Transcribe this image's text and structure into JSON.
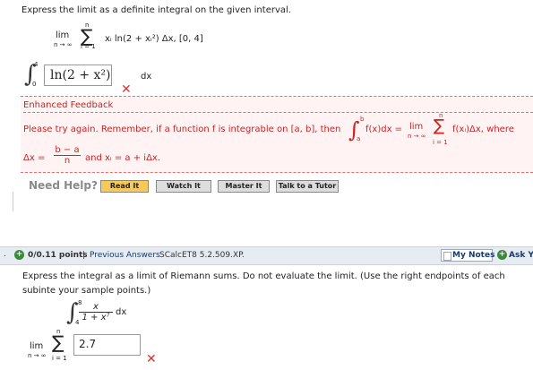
{
  "q1": {
    "prompt": "Express the limit as a definite integral on the given interval.",
    "lim_label": "lim",
    "lim_sub": "n → ∞",
    "sigma_top": "n",
    "sigma_bottom": "i = 1",
    "expression": "xᵢ ln(2 + xᵢ²) Δx,  [0, 4]",
    "answer_upper": "4",
    "answer_lower": "0",
    "answer_value": "ln(2 + x²)",
    "dx": "dx"
  },
  "feedback": {
    "title": "Enhanced Feedback",
    "text_part1": "Please try again. Remember, if a function f is integrable on  [a, b],  then",
    "int_upper": "b",
    "int_lower": "a",
    "int_body": "f(x)dx = ",
    "lim_label": "lim",
    "lim_sub": "n → ∞",
    "sigma_top": "n",
    "sigma_bottom": "i = 1",
    "sum_body": "f(xᵢ)Δx,  where",
    "delta_lhs": "Δx = ",
    "frac_num": "b − a",
    "frac_den": "n",
    "and_text": "and  xᵢ = a + iΔx."
  },
  "help": {
    "label": "Need Help?",
    "buttons": [
      "Read It",
      "Watch It",
      "Master It",
      "Talk to a Tutor"
    ]
  },
  "q2bar": {
    "number": ".",
    "points": "0/0.11 points",
    "sep": "|",
    "prev": "Previous Answers",
    "source": "SCalcET8 5.2.509.XP.",
    "my_notes": "My Notes",
    "ask": "Ask Yo"
  },
  "q2": {
    "prompt": "Express the integral as a limit of Riemann sums. Do not evaluate the limit. (Use the right endpoints of each subinte your sample points.)",
    "int_upper": "8",
    "int_lower": "4",
    "frac_num": "x",
    "frac_den": "1 + x⁷",
    "dx": "dx",
    "lim_label": "lim",
    "lim_sub": "n → ∞",
    "sigma_top": "n",
    "sigma_bottom": "i = 1",
    "answer_value": "2.7"
  },
  "colors": {
    "error": "#e03030",
    "feedback_bg": "#fff3f3",
    "bar_bg": "#e6ecf2",
    "help_primary": "#f7c85a"
  }
}
